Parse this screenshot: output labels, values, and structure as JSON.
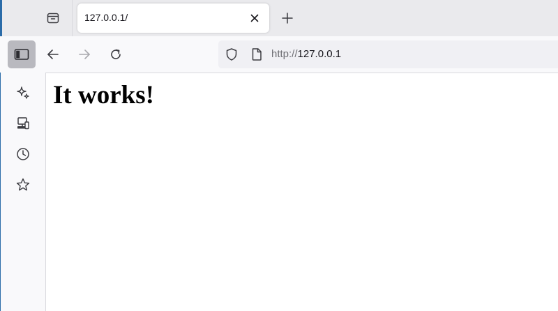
{
  "browser": {
    "tabs": [
      {
        "title": "127.0.0.1/",
        "active": true
      }
    ],
    "url": {
      "scheme": "http://",
      "host": "127.0.0.1"
    },
    "icons": {
      "tab_list": "tab-list-icon",
      "close": "close-icon",
      "new_tab": "plus-icon",
      "sidebar_toggle": "sidebar-toggle-icon",
      "back": "arrow-left-icon",
      "forward": "arrow-right-icon",
      "reload": "reload-icon",
      "tracking_protection": "shield-icon",
      "page_info": "page-icon"
    },
    "colors": {
      "tabstrip_bg": "#eaeaed",
      "toolbar_bg": "#f9f9fb",
      "urlbar_bg": "#f0f0f4",
      "active_toggle_bg": "#b9b9bf",
      "text": "#15141a",
      "muted_text": "#6e6e73"
    }
  },
  "sidebar": {
    "items": [
      {
        "icon": "sparkle-ai-icon"
      },
      {
        "icon": "synced-devices-icon"
      },
      {
        "icon": "history-clock-icon"
      },
      {
        "icon": "bookmarks-star-icon"
      }
    ]
  },
  "page": {
    "heading": "It works!"
  }
}
